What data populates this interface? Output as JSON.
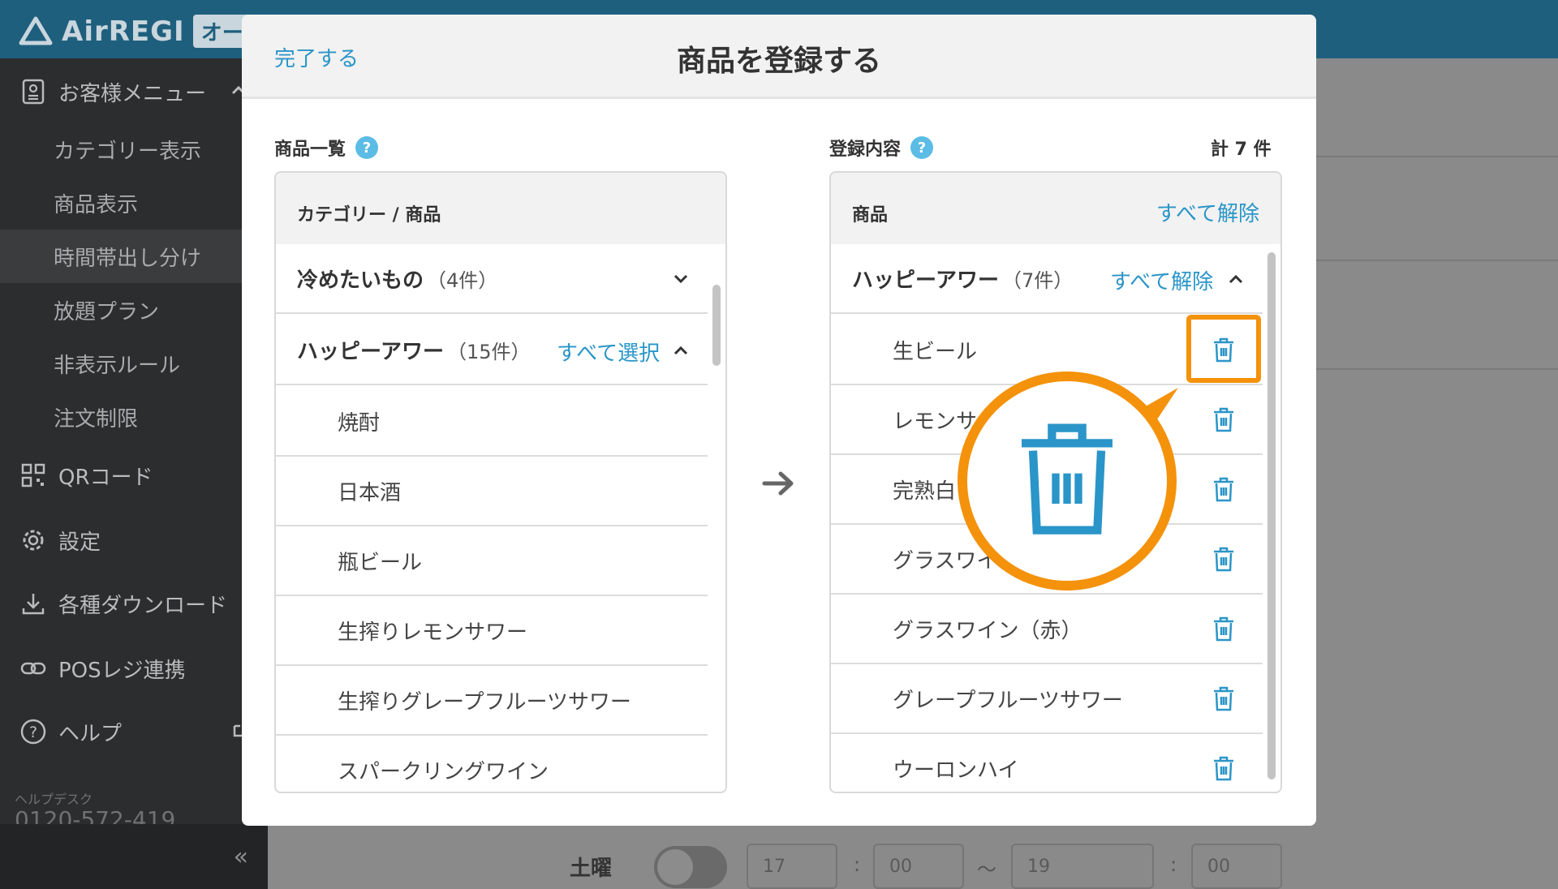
{
  "app": {
    "logo_text": "AirREGI",
    "logo_badge": "オーダ"
  },
  "sidebar": {
    "menu_header": "お客様メニュー",
    "sub_items": [
      "カテゴリー表示",
      "商品表示",
      "時間帯出し分け",
      "放題プラン",
      "非表示ルール",
      "注文制限"
    ],
    "items": [
      "QRコード",
      "設定",
      "各種ダウンロード",
      "POSレジ連携",
      "ヘルプ"
    ],
    "helpdesk_label": "ヘルプデスク",
    "helpdesk_tel": "0120-572-419",
    "collapse": "«"
  },
  "background": {
    "day": "土曜",
    "start_hour": "17",
    "start_min": "00",
    "tilde": "〜",
    "end_hour": "19",
    "end_min": "00",
    "colon": ":"
  },
  "modal": {
    "done": "完了する",
    "title": "商品を登録する",
    "left": {
      "label": "商品一覧",
      "help": "?",
      "header": "カテゴリー / 商品",
      "cat1": {
        "name": "冷めたいもの",
        "count": "（4件）"
      },
      "cat2": {
        "name": "ハッピーアワー",
        "count": "（15件）",
        "action": "すべて選択"
      },
      "items": [
        "焼酎",
        "日本酒",
        "瓶ビール",
        "生搾りレモンサワー",
        "生搾りグレープフルーツサワー",
        "スパークリングワイン"
      ]
    },
    "right": {
      "label": "登録内容",
      "help": "?",
      "total": "計 7 件",
      "header": "商品",
      "clear_all": "すべて解除",
      "cat": {
        "name": "ハッピーアワー",
        "count": "（7件）",
        "action": "すべて解除"
      },
      "items": [
        "生ビール",
        "レモンサワー",
        "完熟白桃サワー",
        "グラスワイン（白）",
        "グラスワイン（赤）",
        "グレープフルーツサワー",
        "ウーロンハイ"
      ],
      "visible_items": [
        "生ビール",
        "レモンサ",
        "完熟白",
        "グラスワイ",
        "グラスワイン（赤）",
        "グレープフルーツサワー",
        "ウーロンハイ"
      ]
    }
  },
  "colors": {
    "accent": "#2a95c8",
    "highlight": "#f4920c",
    "topbar": "#1f5f7e",
    "sidebar": "#2b2d2f"
  },
  "icons": {
    "trash": "trash-icon",
    "arrow": "arrow-right-icon"
  }
}
